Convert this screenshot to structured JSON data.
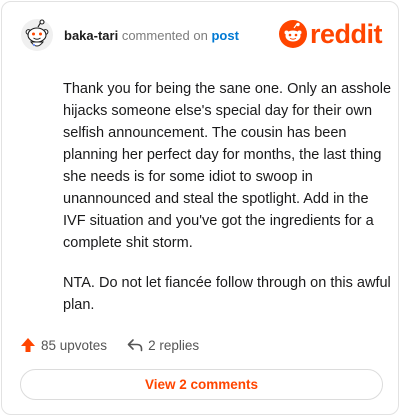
{
  "header": {
    "username": "baka-tari",
    "commented_on": "commented on",
    "post_link": "post",
    "brand": "reddit"
  },
  "comment": {
    "paragraphs": [
      "Thank you for being the sane one. Only an asshole hijacks someone else's special day for their own selfish announcement. The cousin has been planning her perfect day for months, the last thing she needs is for some idiot to swoop in unannounced and steal the spotlight. Add in the IVF situation and you've got the ingredients for a complete shit storm.",
      "NTA. Do not let fiancée follow through on this awful plan."
    ]
  },
  "actions": {
    "upvotes": "85 upvotes",
    "replies": "2 replies"
  },
  "view_button": "View 2 comments",
  "colors": {
    "brand": "#ff4500",
    "link": "#0079d3",
    "text": "#1a1a1b",
    "muted": "#7c7c7c"
  },
  "icons": {
    "avatar": "snoo-avatar-icon",
    "logo": "reddit-logo-icon",
    "upvote": "upvote-arrow-icon",
    "reply": "reply-arrow-icon"
  }
}
